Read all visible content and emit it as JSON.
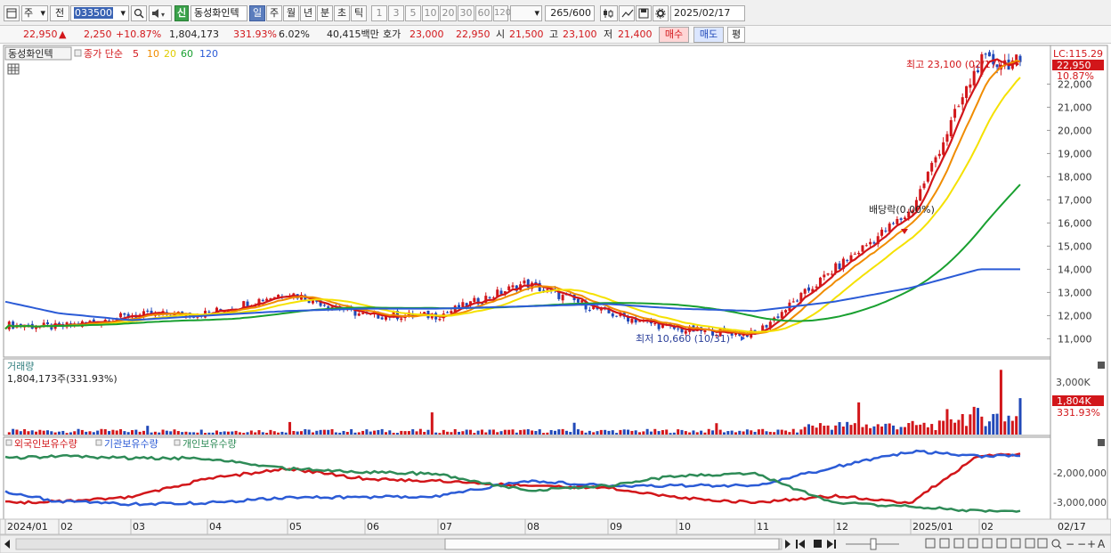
{
  "toolbar": {
    "market_type": "주",
    "prev": "전",
    "stock_code": "033500",
    "badge": "신",
    "stock_name": "동성화인텍",
    "period_tabs": [
      "일",
      "주",
      "월",
      "년",
      "분",
      "초",
      "틱"
    ],
    "selected_period": "일",
    "intervals": [
      "1",
      "3",
      "5",
      "10",
      "20",
      "30",
      "60",
      "120"
    ],
    "count_display": "265/600",
    "date": "2025/02/17"
  },
  "price_info": {
    "price": "22,950",
    "arrow": "▲",
    "change": "2,250",
    "change_pct": "+10.87%",
    "volume": "1,804,173",
    "volume_ratio": "331.93%",
    "turnover": "6.02%",
    "amount": "40,415백만",
    "quote_label": "호가",
    "ask": "23,000",
    "bid": "22,950",
    "open_label": "시",
    "open": "21,500",
    "high_label": "고",
    "high": "23,100",
    "low_label": "저",
    "low": "21,400",
    "buy_button": "매수",
    "sell_button": "매도",
    "avg_button": "평"
  },
  "legend": {
    "name_box": "동성화인텍",
    "ma_label": "종가 단순",
    "ma_periods": [
      "5",
      "10",
      "20",
      "60",
      "120"
    ],
    "ma_colors": [
      "#d2161a",
      "#f08c00",
      "#f5e100",
      "#19a030",
      "#2b5bd6"
    ]
  },
  "annotations": {
    "high_label": "최고 23,100 (02/17)",
    "low_label": "최저 10,660 (10/31)",
    "dividend_label": "배당락(0.00%)",
    "lc_label": "LC:115.29",
    "last_price_tag": "22,950",
    "last_pct_tag": "10.87%"
  },
  "volume_panel": {
    "title": "거래량",
    "value_text": "1,804,173주(331.93%)",
    "axis_label": "3,000K",
    "tag": "1,804K",
    "tag_pct": "331.93%"
  },
  "holdings_panel": {
    "series_names": [
      "외국인보유수량",
      "기관보유수량",
      "개인보유수량"
    ],
    "series_colors": [
      "#d2161a",
      "#2b5bd6",
      "#2e8b57"
    ],
    "axis_labels": [
      "-2,000,000",
      "-3,000,000"
    ]
  },
  "x_axis_labels": [
    "2024/01",
    "02",
    "03",
    "04",
    "05",
    "06",
    "07",
    "08",
    "09",
    "10",
    "11",
    "12",
    "2025/01",
    "02"
  ],
  "x_axis_end_label": "02/17",
  "chart_data": {
    "type": "candlestick",
    "price_axis": {
      "ticks": [
        "22,000",
        "21,000",
        "20,000",
        "19,000",
        "18,000",
        "17,000",
        "16,000",
        "15,000",
        "14,000",
        "13,000",
        "12,000",
        "11,000"
      ],
      "range": [
        10400,
        23400
      ]
    },
    "close_series_by_month": {
      "months": [
        "2024/01",
        "02",
        "03",
        "04",
        "05",
        "06",
        "07",
        "08",
        "09",
        "10",
        "11",
        "12",
        "2025/01",
        "02/17"
      ],
      "close": [
        11600,
        11500,
        12000,
        12100,
        13000,
        12000,
        12000,
        13400,
        12100,
        11400,
        11200,
        14000,
        16500,
        22950
      ]
    },
    "ma120_by_month": [
      12600,
      12100,
      11800,
      12000,
      12200,
      12300,
      12300,
      12400,
      12500,
      12300,
      12200,
      12600,
      13200,
      14000
    ],
    "volume_max": 3000
  }
}
